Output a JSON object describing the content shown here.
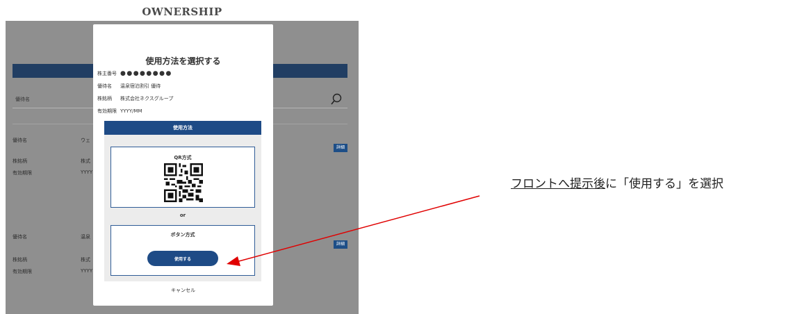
{
  "app": {
    "title": "OWNERSHIP"
  },
  "background": {
    "search_placeholder": "優待名",
    "items": [
      {
        "name_label": "優待名",
        "name_value": "ウェ",
        "brand_label": "株銘柄",
        "brand_value": "株式",
        "expiry_label": "有効期限",
        "expiry_value": "YYYY",
        "detail_label": "詳細"
      },
      {
        "name_label": "優待名",
        "name_value": "温泉",
        "brand_label": "株銘柄",
        "brand_value": "株式",
        "expiry_label": "有効期限",
        "expiry_value": "YYYY",
        "detail_label": "詳細"
      }
    ]
  },
  "modal": {
    "title": "使用方法を選択する",
    "info": [
      {
        "label": "株主番号",
        "value": "●●●●●●●●"
      },
      {
        "label": "優待名",
        "value": "温泉宿泊割引 優待"
      },
      {
        "label": "株銘柄",
        "value": "株式会社ネクスグループ"
      },
      {
        "label": "有効期限",
        "value": "YYYY/MM"
      }
    ],
    "usage_header": "使用方法",
    "qr_title": "QR方式",
    "or_label": "or",
    "button_method_title": "ボタン方式",
    "use_button": "使用する",
    "cancel": "キャンセル"
  },
  "annotation": {
    "text_underlined": "フロントへ提示後",
    "text_rest": "に「使用する」を選択",
    "arrow_color": "#e00000"
  },
  "colors": {
    "accent": "#1e4b86",
    "overlay": "#8f8f8f",
    "header_bar": "#213e63"
  }
}
